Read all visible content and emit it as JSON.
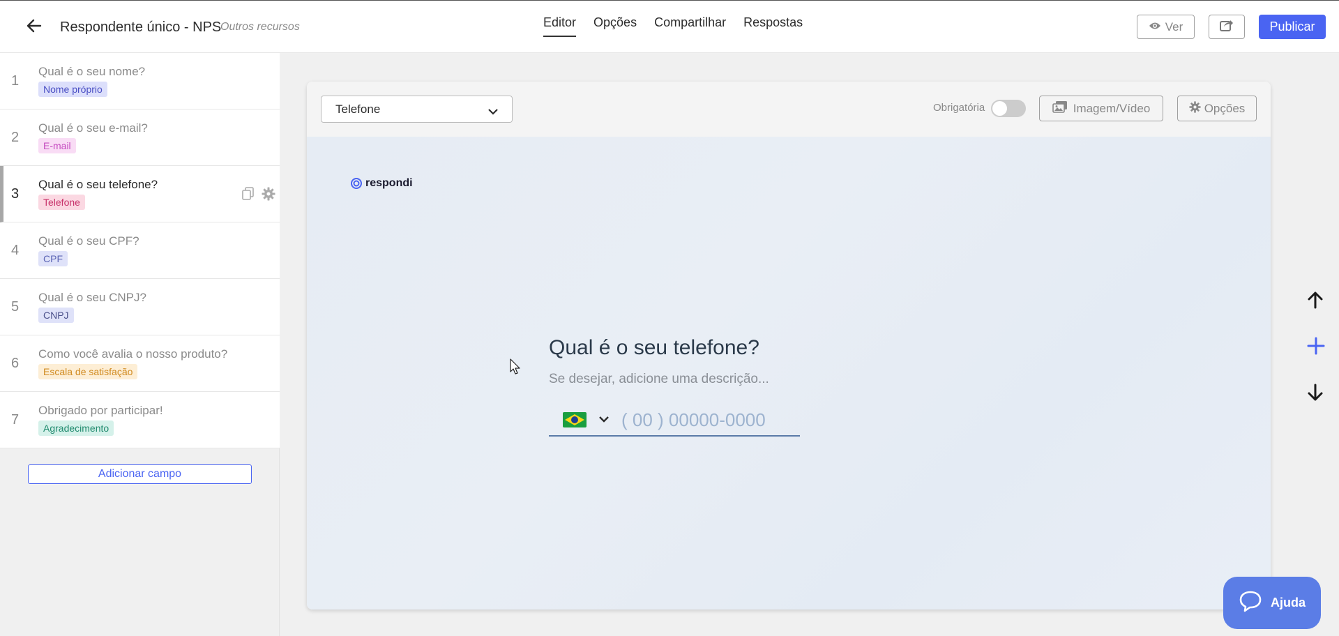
{
  "header": {
    "title": "Respondente único - NPS",
    "subtitle": "Outros recursos",
    "tabs": [
      "Editor",
      "Opções",
      "Compartilhar",
      "Respostas"
    ],
    "view_label": "Ver",
    "publish_label": "Publicar"
  },
  "questions": [
    {
      "num": "1",
      "text": "Qual é o seu nome?",
      "badge": "Nome próprio",
      "badge_bg": "#dcdffb",
      "badge_fg": "#4a4fc4"
    },
    {
      "num": "2",
      "text": "Qual é o seu e-mail?",
      "badge": "E-mail",
      "badge_bg": "#f9dcf5",
      "badge_fg": "#c54bc0"
    },
    {
      "num": "3",
      "text": "Qual é o seu telefone?",
      "badge": "Telefone",
      "badge_bg": "#fbd8e2",
      "badge_fg": "#c8336b"
    },
    {
      "num": "4",
      "text": "Qual é o seu CPF?",
      "badge": "CPF",
      "badge_bg": "#dfe2f9",
      "badge_fg": "#5a63b4"
    },
    {
      "num": "5",
      "text": "Qual é o seu CNPJ?",
      "badge": "CNPJ",
      "badge_bg": "#dfe2f9",
      "badge_fg": "#4a4f8a"
    },
    {
      "num": "6",
      "text": "Como você avalia o nosso produto?",
      "badge": "Escala de satisfação",
      "badge_bg": "#fdeed5",
      "badge_fg": "#d08a1f"
    },
    {
      "num": "7",
      "text": "Obrigado por participar!",
      "badge": "Agradecimento",
      "badge_bg": "#d5f1ea",
      "badge_fg": "#1f8a6d"
    }
  ],
  "sidebar": {
    "add_field_label": "Adicionar campo"
  },
  "editor": {
    "type_value": "Telefone",
    "required_label": "Obrigatória",
    "required_on": false,
    "media_label": "Imagem/Vídeo",
    "options_label": "Opções"
  },
  "preview": {
    "logo_text": "respondi",
    "question": "Qual é o seu telefone?",
    "description_placeholder": "Se desejar, adicione uma descrição...",
    "phone_placeholder": "( 00 )  00000-0000"
  },
  "help": {
    "label": "Ajuda"
  },
  "colors": {
    "accent": "#4a64f2",
    "help": "#5b7de6"
  }
}
